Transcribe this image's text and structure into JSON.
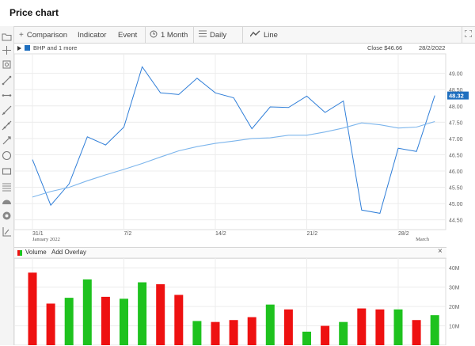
{
  "app": {
    "title": "Price chart"
  },
  "toolbar": {
    "comparison_label": "Comparison",
    "indicator_label": "Indicator",
    "event_label": "Event",
    "range_label": "1 Month",
    "interval_label": "Daily",
    "charttype_label": "Line"
  },
  "legend": {
    "series_label": "BHP and 1 more",
    "close_label": "Close $46.66",
    "date_label": "28/2/2022",
    "price_badge": "48.32",
    "series_color": "#2f7ed8",
    "badge_color": "#1f6fbf"
  },
  "volume_panel": {
    "label": "Volume",
    "add_overlay_label": "Add Overlay",
    "close_label": "×",
    "up_color": "#1ec21e",
    "down_color": "#ee1111"
  },
  "tools": [
    "folder-icon",
    "crosshair-icon",
    "zoom-fit-icon",
    "line-icon",
    "horizontal-line-icon",
    "ray-icon",
    "trend-line-icon",
    "arrow-line-icon",
    "circle-icon",
    "rectangle-icon",
    "fibonacci-icon",
    "arc-icon",
    "target-icon",
    "measure-icon"
  ],
  "chart_data": [
    {
      "type": "line",
      "x": [
        "2022-01-31",
        "2022-02-01",
        "2022-02-02",
        "2022-02-03",
        "2022-02-04",
        "2022-02-07",
        "2022-02-08",
        "2022-02-09",
        "2022-02-10",
        "2022-02-11",
        "2022-02-14",
        "2022-02-15",
        "2022-02-16",
        "2022-02-17",
        "2022-02-18",
        "2022-02-21",
        "2022-02-22",
        "2022-02-23",
        "2022-02-24",
        "2022-02-25",
        "2022-02-28",
        "2022-03-01",
        "2022-03-02"
      ],
      "series": [
        {
          "values": [
            46.35,
            44.95,
            45.6,
            47.05,
            46.8,
            47.35,
            49.2,
            48.4,
            48.35,
            48.85,
            48.4,
            48.25,
            47.3,
            47.97,
            47.95,
            48.3,
            47.8,
            48.15,
            44.8,
            44.7,
            46.7,
            46.6,
            48.32
          ]
        },
        {
          "values": [
            45.2,
            45.37,
            45.5,
            45.7,
            45.88,
            46.05,
            46.23,
            46.43,
            46.62,
            46.75,
            46.85,
            46.92,
            47.0,
            47.02,
            47.1,
            47.1,
            47.2,
            47.32,
            47.48,
            47.42,
            47.32,
            47.35,
            47.52
          ]
        }
      ],
      "x_tick_labels": [
        "31/1",
        "7/2",
        "14/2",
        "21/2",
        "28/2"
      ],
      "x_sublabels": [
        "January 2022",
        "March"
      ],
      "y_tick_labels": [
        "44.50",
        "45.00",
        "45.50",
        "46.00",
        "46.50",
        "47.00",
        "47.50",
        "48.00",
        "48.50",
        "49.00"
      ],
      "ylim": [
        44.2,
        49.6
      ],
      "grid": true
    },
    {
      "type": "bar",
      "x": [
        "2022-01-31",
        "2022-02-01",
        "2022-02-02",
        "2022-02-03",
        "2022-02-04",
        "2022-02-07",
        "2022-02-08",
        "2022-02-09",
        "2022-02-10",
        "2022-02-11",
        "2022-02-14",
        "2022-02-15",
        "2022-02-16",
        "2022-02-17",
        "2022-02-18",
        "2022-02-21",
        "2022-02-22",
        "2022-02-23",
        "2022-02-24",
        "2022-02-25",
        "2022-02-28",
        "2022-03-01",
        "2022-03-02"
      ],
      "values": [
        37.5,
        21.5,
        24.5,
        34,
        25,
        24,
        32.5,
        31.5,
        26,
        12.5,
        12,
        13,
        14.5,
        21,
        18.5,
        7,
        10,
        12,
        19,
        18.5,
        18.5,
        13,
        15.5
      ],
      "directions": [
        "down",
        "down",
        "up",
        "up",
        "down",
        "up",
        "up",
        "down",
        "down",
        "up",
        "down",
        "down",
        "down",
        "up",
        "down",
        "up",
        "down",
        "up",
        "down",
        "down",
        "up",
        "down",
        "up"
      ],
      "unit": "M",
      "y_tick_labels": [
        "10M",
        "20M",
        "30M",
        "40M"
      ],
      "ylim": [
        0,
        45
      ],
      "grid": true
    }
  ]
}
